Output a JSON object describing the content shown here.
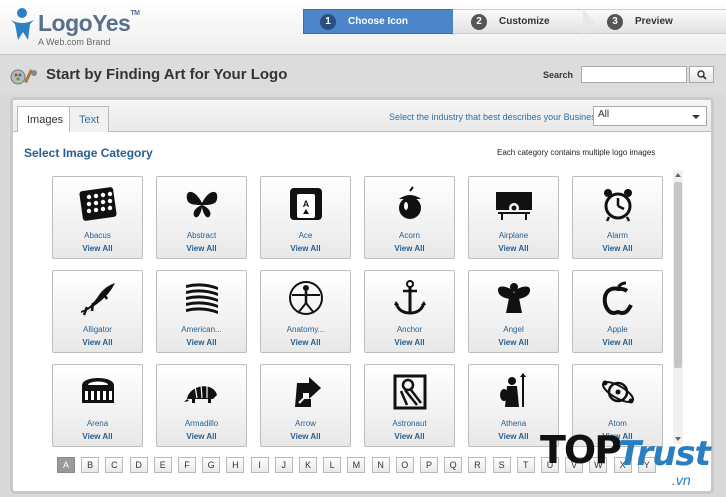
{
  "brand": {
    "name": "LogoYes",
    "tm": "TM",
    "sub": "A Web.com Brand"
  },
  "steps": [
    {
      "num": "1",
      "label": "Choose Icon"
    },
    {
      "num": "2",
      "label": "Customize"
    },
    {
      "num": "3",
      "label": "Preview"
    }
  ],
  "page": {
    "title": "Start by Finding Art for Your Logo"
  },
  "search": {
    "label": "Search",
    "value": "",
    "placeholder": ""
  },
  "tabs": {
    "images": "Images",
    "text": "Text"
  },
  "industry": {
    "label": "Select the industry that best describes your Business:",
    "selected": "All"
  },
  "category": {
    "title": "Select Image Category",
    "note": "Each category contains multiple logo images",
    "view_all": "View All",
    "items": [
      {
        "name": "Abacus",
        "icon": "abacus-icon"
      },
      {
        "name": "Abstract",
        "icon": "butterfly-icon"
      },
      {
        "name": "Ace",
        "icon": "ace-card-icon"
      },
      {
        "name": "Acorn",
        "icon": "acorn-icon"
      },
      {
        "name": "Airplane",
        "icon": "airplane-icon"
      },
      {
        "name": "Alarm",
        "icon": "alarm-clock-icon"
      },
      {
        "name": "Alligator",
        "icon": "alligator-icon"
      },
      {
        "name": "American...",
        "icon": "flag-icon"
      },
      {
        "name": "Anatomy...",
        "icon": "vitruvian-man-icon"
      },
      {
        "name": "Anchor",
        "icon": "anchor-icon"
      },
      {
        "name": "Angel",
        "icon": "angel-icon"
      },
      {
        "name": "Apple",
        "icon": "apple-icon"
      },
      {
        "name": "Arena",
        "icon": "arena-icon"
      },
      {
        "name": "Armadillo",
        "icon": "armadillo-icon"
      },
      {
        "name": "Arrow",
        "icon": "arrow-icon"
      },
      {
        "name": "Astronaut",
        "icon": "astronaut-icon"
      },
      {
        "name": "Athena",
        "icon": "athena-icon"
      },
      {
        "name": "Atom",
        "icon": "atom-icon"
      }
    ]
  },
  "alphabet": [
    "A",
    "B",
    "C",
    "D",
    "E",
    "F",
    "G",
    "H",
    "I",
    "J",
    "K",
    "L",
    "M",
    "N",
    "O",
    "P",
    "Q",
    "R",
    "S",
    "T",
    "U",
    "V",
    "W",
    "X",
    "Y"
  ],
  "alphabet_active": "A",
  "watermark": {
    "top": "TOP",
    "trust": "Trust",
    "vn": ".vn"
  },
  "colors": {
    "accent": "#4c86c9",
    "link": "#2a5e8c"
  }
}
